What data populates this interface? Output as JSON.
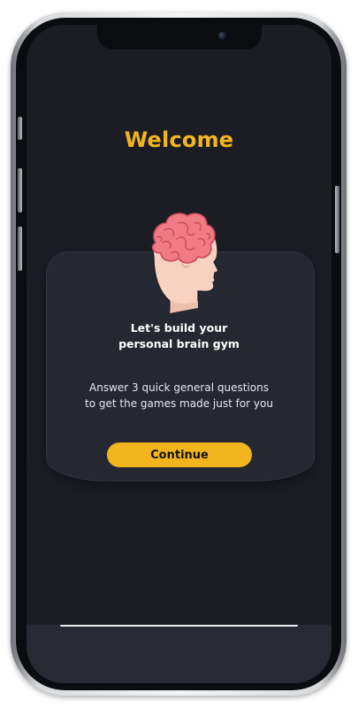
{
  "screen": {
    "title": "Welcome",
    "heading_lines": [
      "Let's build your",
      "personal brain gym"
    ],
    "subtext_lines": [
      "Answer 3 quick general questions",
      "to get the games made just for you"
    ],
    "continue_label": "Continue"
  },
  "icons": {
    "illustration": "head-with-brain-icon"
  },
  "colors": {
    "accent": "#f2b51d",
    "background": "#1c1d24",
    "card": "#252731",
    "brain": "#f07a86",
    "skin": "#f7d2c2"
  }
}
